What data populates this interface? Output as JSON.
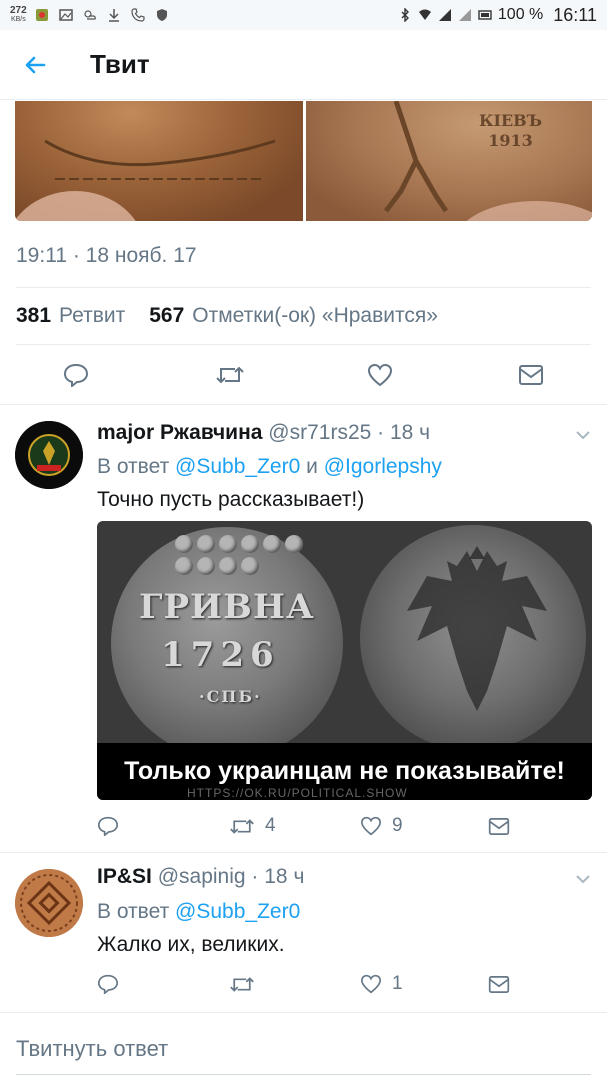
{
  "status_bar": {
    "speed_value": "272",
    "speed_unit": "KB/s",
    "battery_percent": "100 %",
    "time": "16:11"
  },
  "header": {
    "back_icon": "arrow-left-icon",
    "title": "Твит"
  },
  "main_tweet": {
    "image_text_right": "КІЕВЪ",
    "image_text_year": "1913",
    "timestamp": "19:11 · 18 нояб. 17",
    "retweet_count": "381",
    "retweet_label": "Ретвит",
    "like_count": "567",
    "like_label": "Отметки(-ок) «Нравится»"
  },
  "replies": [
    {
      "name": "major Ржавчина",
      "handle": "@sr71rs25",
      "time": "· 18 ч",
      "reply_prefix": "В ответ",
      "mention1": "@Subb_Zer0",
      "conjunction": "и",
      "mention2": "@Igorlepshy",
      "text": "Точно пусть рассказывает!)",
      "image": {
        "coin_word": "ГРИВНА",
        "coin_year": "1726",
        "coin_mint": "·СПБ·",
        "caption": "Только украинцам не показывайте!",
        "watermark": "HTTPS://OK.RU/POLITICAL.SHOW"
      },
      "retweets": "4",
      "likes": "9"
    },
    {
      "name": "IP&SI",
      "handle": "@sapinig",
      "time": "· 18 ч",
      "reply_prefix": "В ответ",
      "mention1": "@Subb_Zer0",
      "text": "Жалко их, великих.",
      "retweets": "",
      "likes": "1"
    }
  ],
  "reply_input": {
    "placeholder": "Твитнуть ответ"
  },
  "colors": {
    "accent": "#1da1f2",
    "secondary_text": "#657786",
    "primary_text": "#14171a",
    "divider": "#e6ecf0"
  }
}
